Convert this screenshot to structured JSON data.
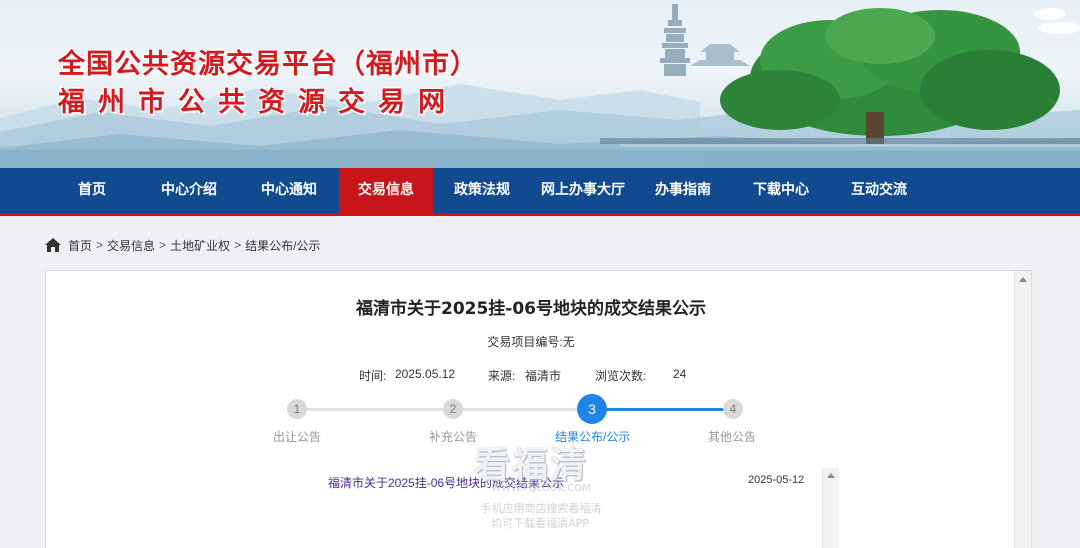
{
  "banner": {
    "title_line1": "全国公共资源交易平台（福州市）",
    "title_line2": "福州市公共资源交易网"
  },
  "nav": {
    "items": [
      {
        "label": "首页"
      },
      {
        "label": "中心介绍"
      },
      {
        "label": "中心通知"
      },
      {
        "label": "交易信息"
      },
      {
        "label": "政策法规"
      },
      {
        "label": "网上办事大厅"
      },
      {
        "label": "办事指南"
      },
      {
        "label": "下载中心"
      },
      {
        "label": "互动交流"
      }
    ],
    "active": "交易信息"
  },
  "breadcrumb": {
    "items": [
      "首页",
      "交易信息",
      "土地矿业权",
      "结果公布/公示"
    ],
    "separator": ">"
  },
  "article": {
    "title": "福清市关于2025挂-06号地块的成交结果公示",
    "project_no": "交易项目编号:无",
    "time_label": "时间:",
    "time_value": "2025.05.12",
    "source_label": "来源:",
    "source_value": "福清市",
    "views_label": "浏览次数:",
    "views_value": "24"
  },
  "steps": [
    {
      "number": "1",
      "label": "出让公告"
    },
    {
      "number": "2",
      "label": "补充公告"
    },
    {
      "number": "3",
      "label": "结果公布/公示",
      "active": true
    },
    {
      "number": "4",
      "label": "其他公告"
    }
  ],
  "list": {
    "items": [
      {
        "title": "福清市关于2025挂-06号地块的成交结果公示",
        "date": "2025-05-12"
      }
    ]
  },
  "watermark": {
    "brand": "看福清",
    "url": "WWW.FQLOOK.COM",
    "line1": "手机应用商店搜索看福清",
    "line2": "均可下载看福清APP"
  },
  "colors": {
    "nav_bg": "#124a8f",
    "nav_active": "#c8151b",
    "title_red": "#d4191f",
    "step_active": "#1e86e6",
    "link_purple": "#4b2c8c"
  }
}
